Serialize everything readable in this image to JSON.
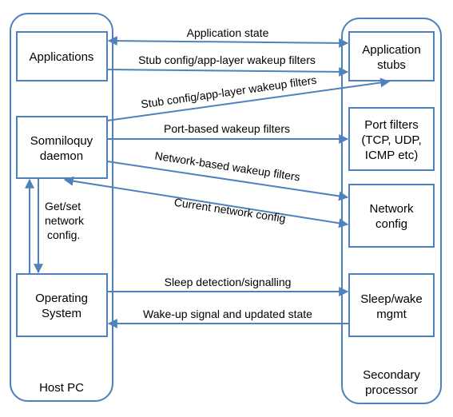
{
  "diagram": {
    "accent_color": "#4f81bd",
    "containers": {
      "host": {
        "label": "Host PC"
      },
      "secondary": {
        "label_line1": "Secondary",
        "label_line2": "processor"
      }
    },
    "host_boxes": {
      "applications": {
        "line1": "Applications"
      },
      "daemon": {
        "line1": "Somniloquy",
        "line2": "daemon"
      },
      "os": {
        "line1": "Operating",
        "line2": "System"
      }
    },
    "secondary_boxes": {
      "app_stubs": {
        "line1": "Application",
        "line2": "stubs"
      },
      "port_filters": {
        "line1": "Port filters",
        "line2": "(TCP, UDP,",
        "line3": "ICMP etc)"
      },
      "network_config": {
        "line1": "Network",
        "line2": "config"
      },
      "sleep_wake": {
        "line1": "Sleep/wake",
        "line2": "mgmt"
      }
    },
    "edges": {
      "app_state": {
        "label": "Application state",
        "from": "Applications",
        "to": "Application stubs",
        "direction": "bidirectional"
      },
      "stub_config_apps": {
        "label": "Stub config/app-layer wakeup filters",
        "from": "Applications",
        "to": "Application stubs"
      },
      "stub_config_daemon": {
        "label": "Stub config/app-layer wakeup filters",
        "from": "Somniloquy daemon",
        "to": "Application stubs"
      },
      "port_filters": {
        "label": "Port-based wakeup filters",
        "from": "Somniloquy daemon",
        "to": "Port filters"
      },
      "network_filters": {
        "label": "Network-based wakeup filters",
        "from": "Somniloquy daemon",
        "to": "Network config"
      },
      "current_config": {
        "label": "Current  network config",
        "from": "Network config",
        "to": "Somniloquy daemon",
        "direction": "bidirectional"
      },
      "get_set": {
        "line1": "Get/set",
        "line2": "network",
        "line3": "config.",
        "from": "Somniloquy daemon",
        "to": "Operating System",
        "direction": "bidirectional"
      },
      "sleep_detect": {
        "label": "Sleep detection/signalling",
        "from": "Operating System",
        "to": "Sleep/wake mgmt"
      },
      "wakeup": {
        "label": "Wake-up signal and updated state",
        "from": "Sleep/wake mgmt",
        "to": "Operating System"
      }
    }
  }
}
